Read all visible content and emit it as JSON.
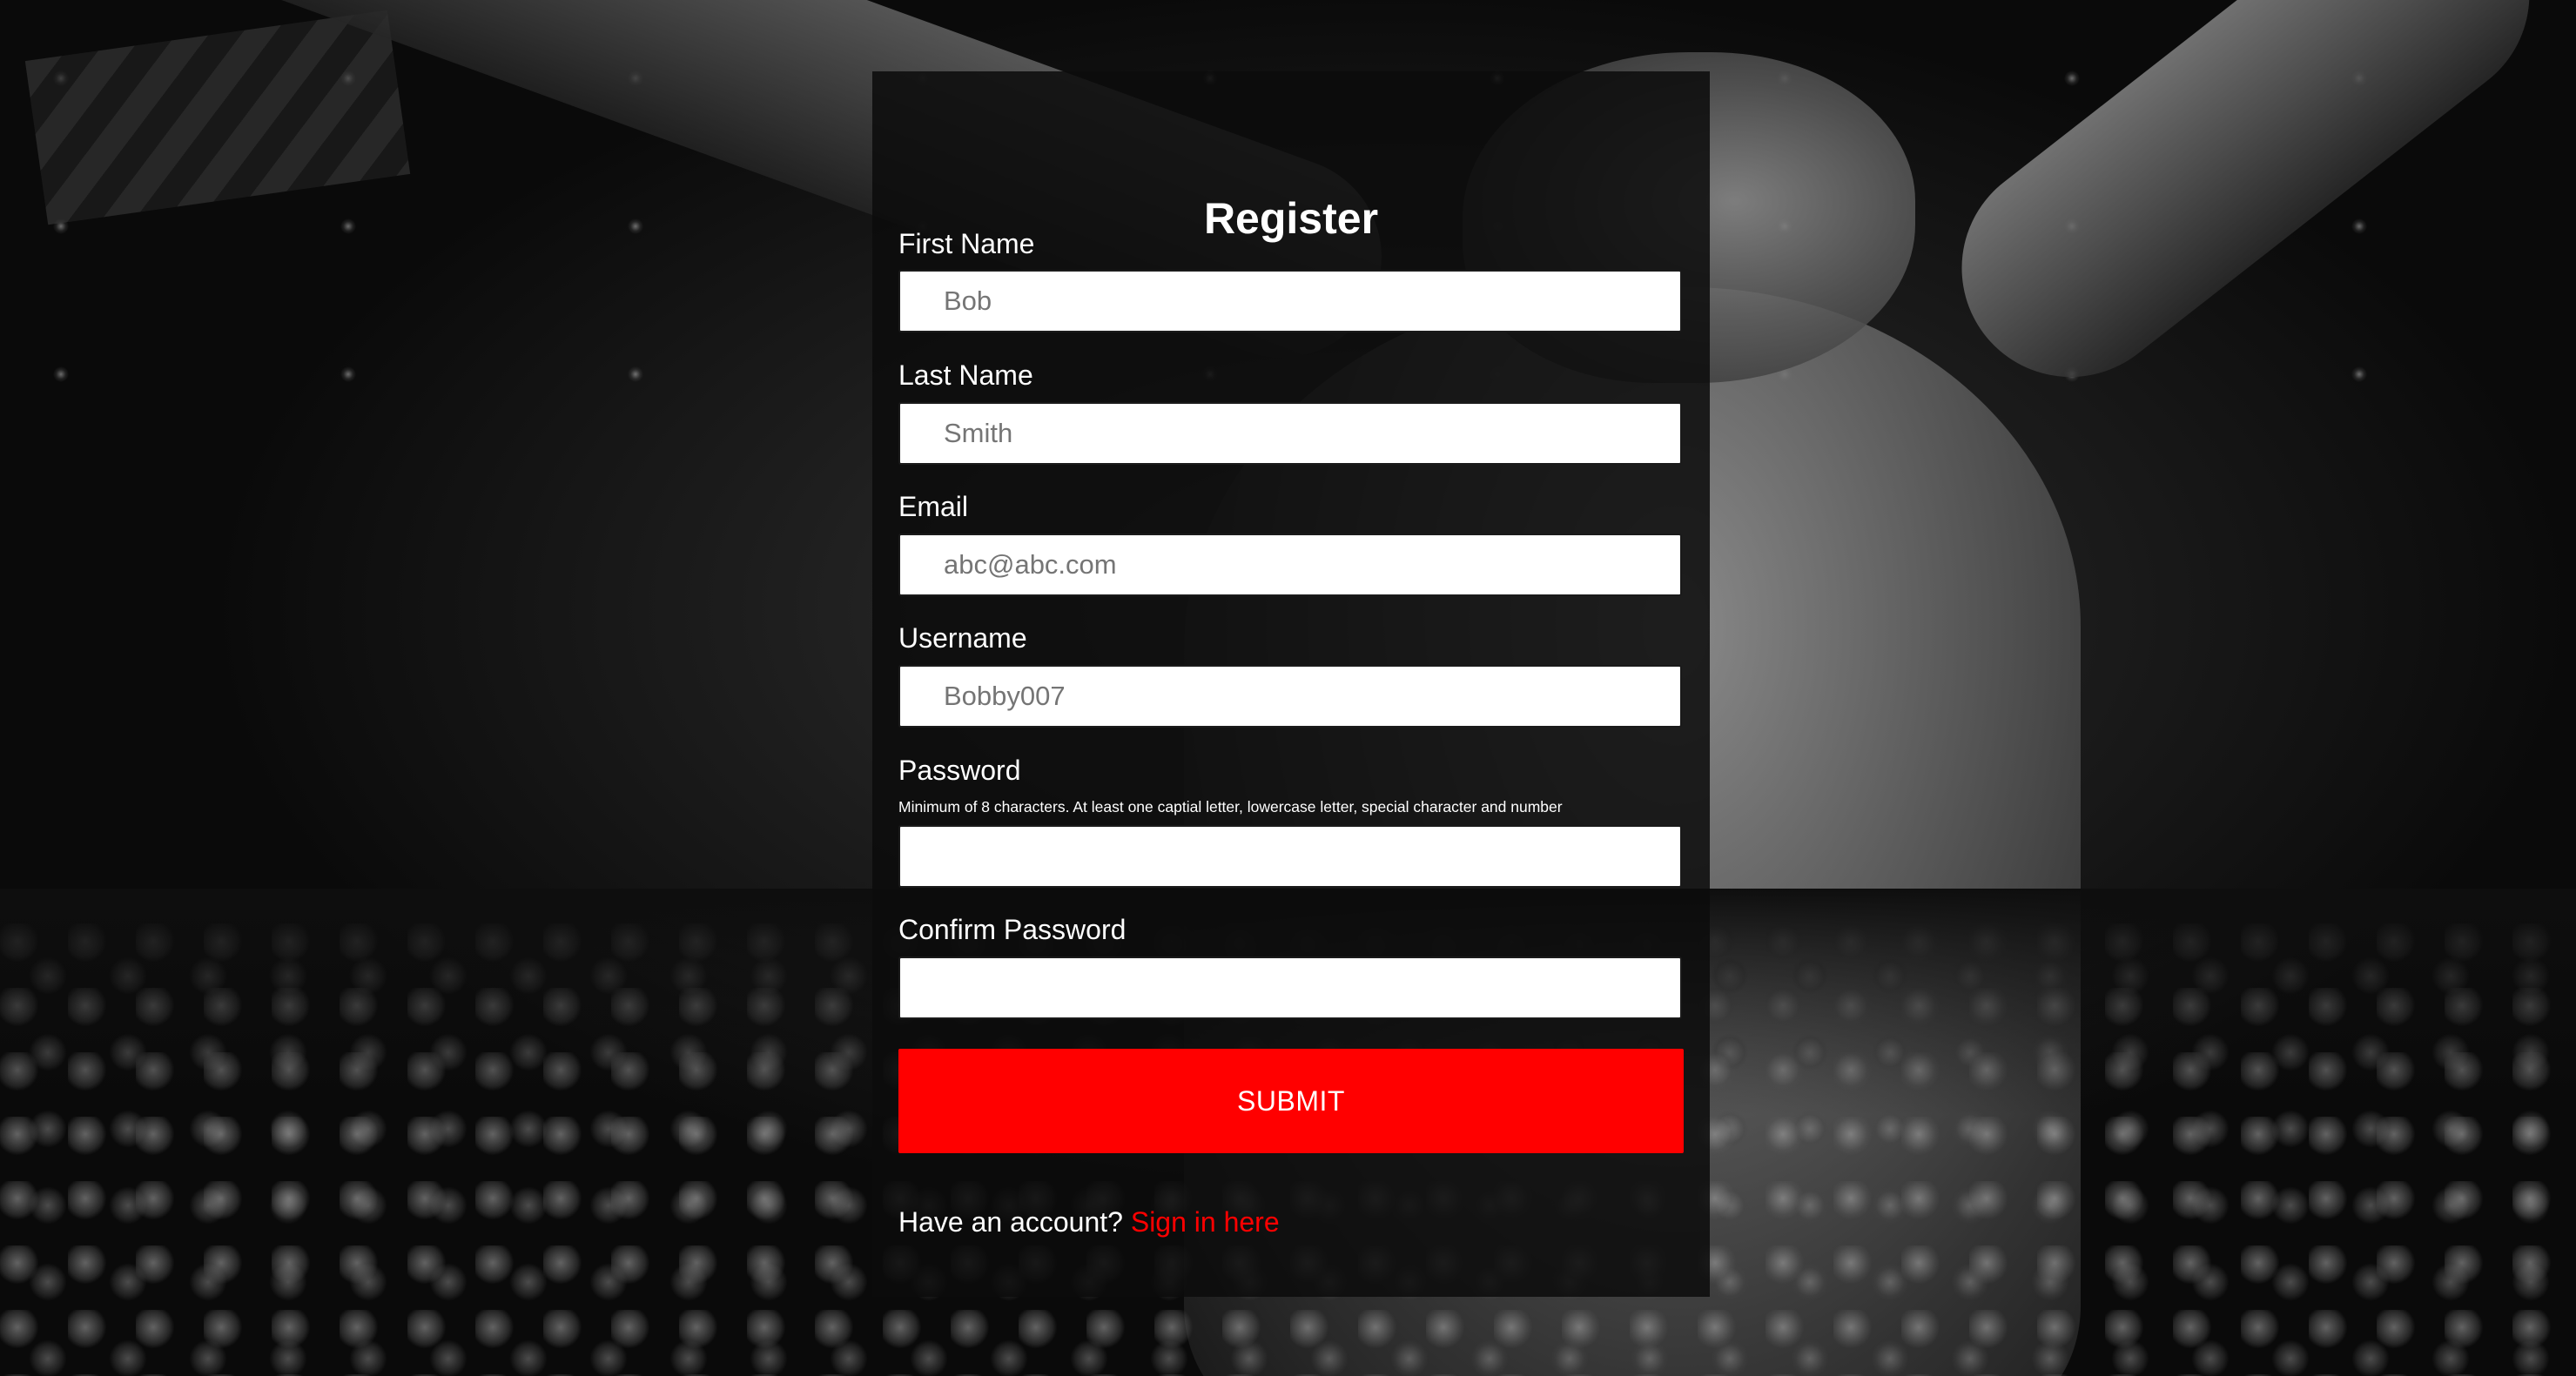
{
  "form": {
    "title": "Register",
    "fields": [
      {
        "label": "First Name",
        "placeholder": "Bob",
        "type": "text"
      },
      {
        "label": "Last Name",
        "placeholder": "Smith",
        "type": "text"
      },
      {
        "label": "Email",
        "placeholder": "abc@abc.com",
        "type": "email"
      },
      {
        "label": "Username",
        "placeholder": "Bobby007",
        "type": "text"
      },
      {
        "label": "Password",
        "hint": "Minimum of 8 characters. At least one captial letter, lowercase letter, special character and number",
        "placeholder": "",
        "type": "password"
      },
      {
        "label": "Confirm Password",
        "placeholder": "",
        "type": "password"
      }
    ],
    "submit_label": "SUBMIT",
    "footer": {
      "prompt": "Have an account?",
      "link_label": "Sign in here"
    }
  },
  "colors": {
    "accent": "#ff0000",
    "panel_background": "#0c0c0c",
    "input_background": "#ffffff",
    "text": "#ffffff"
  }
}
